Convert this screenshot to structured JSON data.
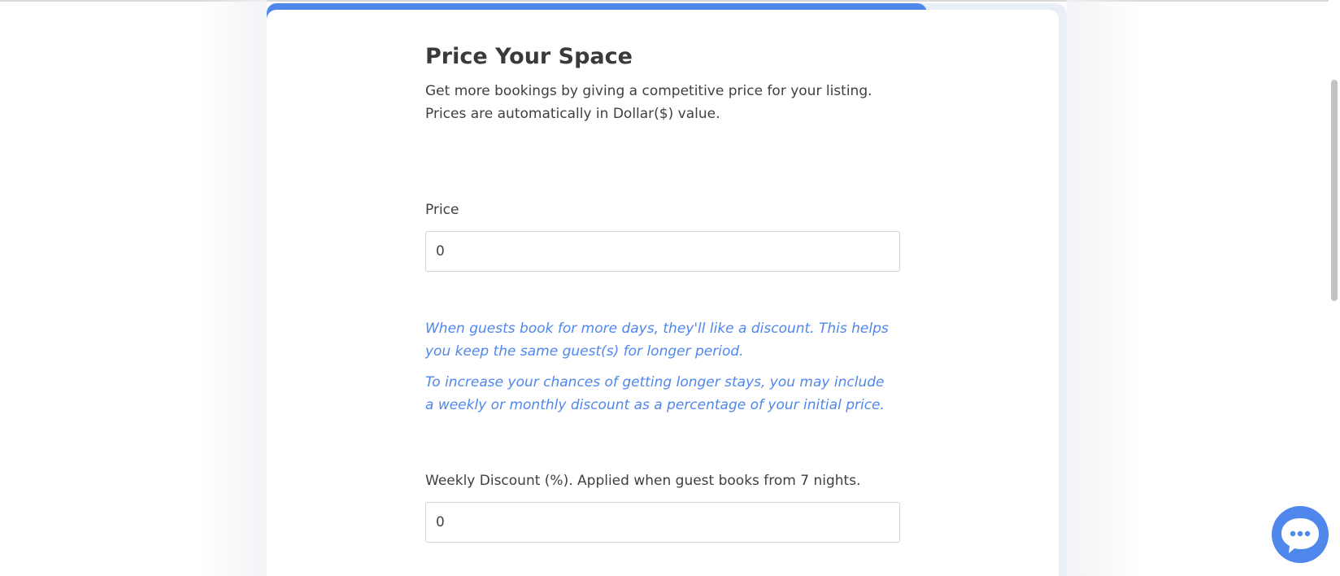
{
  "page": {
    "title": "Price Your Space",
    "subtitle_lines": [
      "Get more bookings by giving a competitive price for your listing.",
      "Prices are automatically in Dollar($) value."
    ]
  },
  "progress": {
    "fraction": 0.82
  },
  "price": {
    "label": "Price",
    "value": "0"
  },
  "hints": {
    "discount_intro": [
      "When guests book for more days, they'll like a discount. This helps",
      "you keep the same guest(s) for longer period."
    ],
    "discount_tip": [
      "To increase your chances of getting longer stays, you may include",
      "a weekly or monthly discount as a percentage of your initial price."
    ]
  },
  "weekly_discount": {
    "label": "Weekly Discount (%). Applied when guest books from 7 nights.",
    "value": "0"
  },
  "chat": {
    "icon": "chat-bubble-icon"
  },
  "colors": {
    "accent": "#4f87ec",
    "text": "#3f3f3f",
    "card_back": "#e9eef7"
  }
}
